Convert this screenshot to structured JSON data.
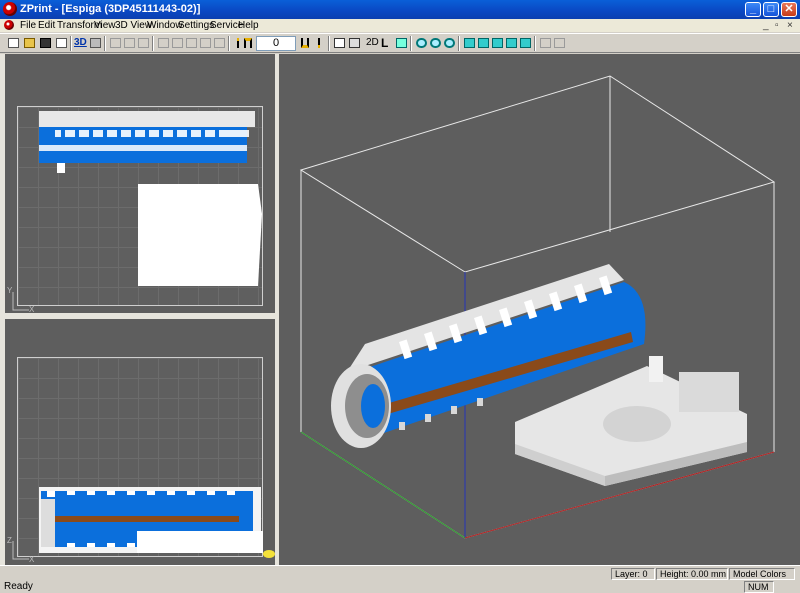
{
  "window": {
    "title": "ZPrint - [Espiga (3DP45111443-02)]",
    "minimize_glyph": "_",
    "maximize_glyph": "□",
    "close_glyph": "✕"
  },
  "menu": {
    "items": [
      "File",
      "Edit",
      "Transform",
      "View",
      "3D View",
      "Window",
      "Settings",
      "Service",
      "Help"
    ],
    "mdi_minimize": "_",
    "mdi_restore": "▫",
    "mdi_close": "×"
  },
  "toolbar": {
    "layer_value": "0",
    "view_3d_label": "3D",
    "view_2d_label": "2D",
    "view_l_label": "L"
  },
  "views": {
    "top_axis_y": "Y",
    "top_axis_x": "X",
    "front_axis_z": "Z",
    "front_axis_x": "X"
  },
  "status": {
    "ready": "Ready",
    "layer": "Layer: 0",
    "height": "Height: 0.00 mm",
    "color_mode": "Model Colors",
    "num": "NUM"
  },
  "colors": {
    "titlebar": "#0a47c2",
    "viewport_bg": "#5e5e5e",
    "part_blue": "#0b6fdc",
    "part_brown": "#8a4a1a"
  }
}
